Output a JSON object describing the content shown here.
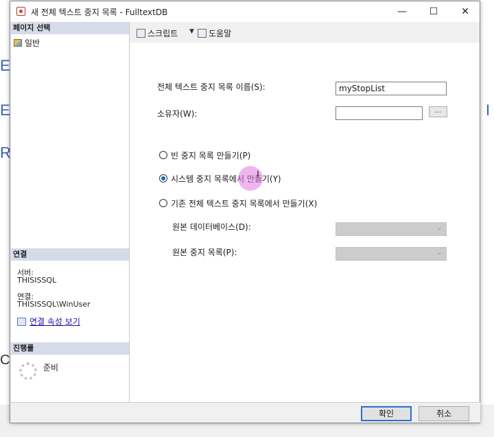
{
  "background": {
    "letters": [
      "E",
      "E",
      "R",
      "I",
      "C"
    ]
  },
  "window": {
    "title": "새 전체 텍스트 중지 목록 - FulltextDB",
    "minimize_glyph": "—",
    "maximize_glyph": "☐",
    "close_glyph": "✕"
  },
  "left_panel": {
    "page_select_header": "페이지 선택",
    "pages": [
      {
        "label": "일반",
        "icon": "general-page-icon"
      }
    ],
    "connection_header": "연결",
    "server_label": "서버:",
    "server_value": "THISISSQL",
    "connection_label": "연결:",
    "connection_value": "THISISSQL\\WinUser",
    "view_props_link": "연결 속성 보기",
    "progress_header": "진행률",
    "status": "준비"
  },
  "toolbar": {
    "script_label": "스크립트",
    "help_label": "도움말"
  },
  "form": {
    "name_label": "전체 텍스트 중지 목록 이름(S):",
    "name_value": "myStopList",
    "owner_label": "소유자(W):",
    "owner_value": "",
    "browse_label": "...",
    "radio_empty": "빈 중지 목록 만들기(P)",
    "radio_system": "시스템 중지 목록에서 만들기(Y)",
    "radio_existing": "기존 전체 텍스트 중지 목록에서 만들기(X)",
    "selected_option": "radio_system",
    "source_db_label": "원본 데이터베이스(D):",
    "source_list_label": "원본 중지 목록(P):"
  },
  "buttons": {
    "ok": "확인",
    "cancel": "취소"
  },
  "colors": {
    "accent": "#2b6fcf",
    "section_header": "#d6dbe9",
    "cursor_highlight": "#e178e1"
  }
}
